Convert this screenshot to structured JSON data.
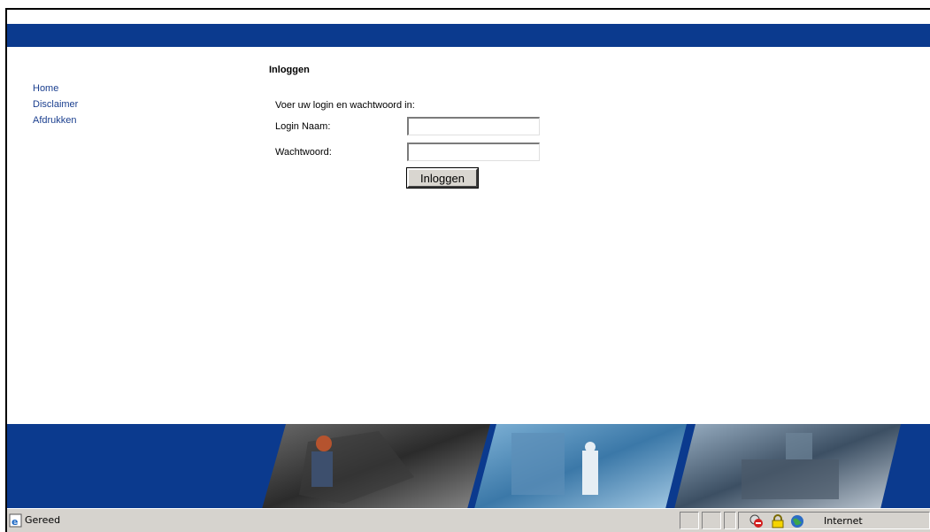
{
  "nav": {
    "items": [
      {
        "label": "Home"
      },
      {
        "label": "Disclaimer"
      },
      {
        "label": "Afdrukken"
      }
    ]
  },
  "main": {
    "title": "Inloggen",
    "instruction": "Voer uw login en wachtwoord in:",
    "login_label": "Login Naam:",
    "login_value": "",
    "password_label": "Wachtwoord:",
    "password_value": "",
    "submit_label": "Inloggen"
  },
  "statusbar": {
    "status_text": "Gereed",
    "zone_text": "Internet"
  },
  "colors": {
    "header_blue": "#0b3a8e",
    "link_blue": "#1b3f8f",
    "statusbar_gray": "#d6d3ce"
  },
  "icons": {
    "status": "ie-page-icon",
    "popup_blocked": "popup-blocked-icon",
    "lock": "lock-icon",
    "zone": "globe-icon"
  }
}
